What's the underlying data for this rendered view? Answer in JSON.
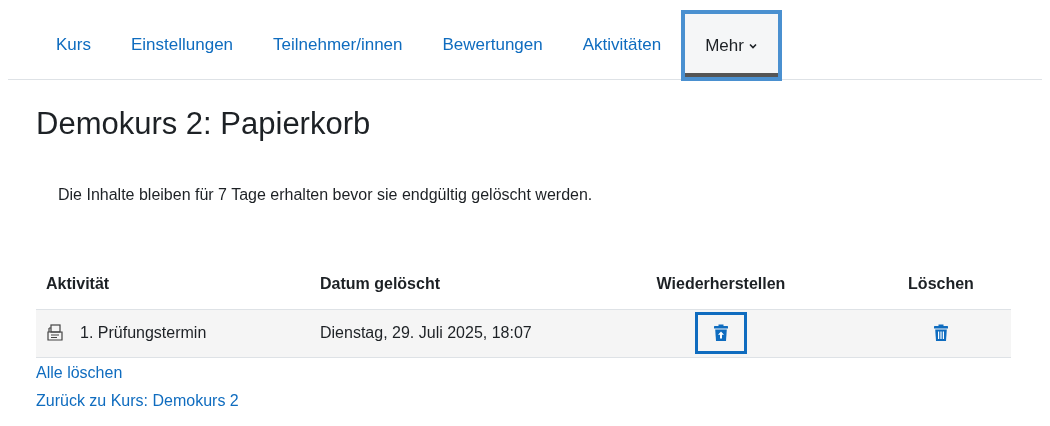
{
  "tabs": [
    {
      "label": "Kurs",
      "selected": false
    },
    {
      "label": "Einstellungen",
      "selected": false
    },
    {
      "label": "Teilnehmer/innen",
      "selected": false
    },
    {
      "label": "Bewertungen",
      "selected": false
    },
    {
      "label": "Aktivitäten",
      "selected": false
    },
    {
      "label": "Mehr",
      "selected": true,
      "dropdown": true
    }
  ],
  "title": "Demokurs 2: Papierkorb",
  "notice": "Die Inhalte bleiben für 7 Tage erhalten bevor sie endgültig gelöscht werden.",
  "table": {
    "columns": [
      "Aktivität",
      "Datum gelöscht",
      "Wiederherstellen",
      "Löschen"
    ],
    "rows": [
      {
        "activity": "1. Prüfungstermin",
        "date": "Dienstag, 29. Juli 2025, 18:07",
        "restore_focused": true
      }
    ]
  },
  "links": [
    "Alle löschen",
    "Zurück zu Kurs: Demokurs 2"
  ]
}
